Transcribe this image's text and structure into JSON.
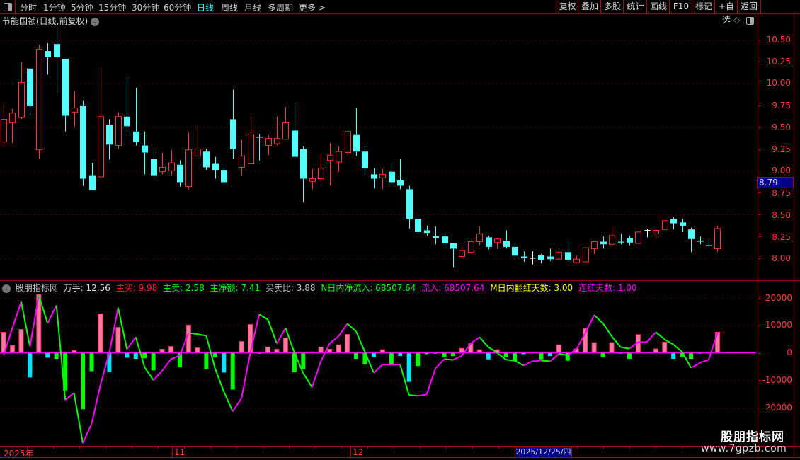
{
  "toolbar": {
    "periods": [
      "分时",
      "1分钟",
      "5分钟",
      "15分钟",
      "30分钟",
      "60分钟",
      "日线",
      "周线",
      "月线",
      "多周期",
      "更多 >"
    ],
    "active_period": "日线",
    "buttons": [
      "复权",
      "叠加",
      "多股",
      "统计",
      "画线",
      "F10",
      "标记",
      "+自选",
      "返回"
    ]
  },
  "price_chart": {
    "title": "节能国祯(日线,前复权)",
    "axis_labels": [
      "10.50",
      "10.25",
      "10.00",
      "9.75",
      "9.50",
      "9.25",
      "9.00",
      "8.75",
      "8.50",
      "8.25",
      "8.00"
    ],
    "axis_values": [
      10.5,
      10.25,
      10.0,
      9.75,
      9.5,
      9.25,
      9.0,
      8.75,
      8.5,
      8.25,
      8.0
    ],
    "current_price": "8.79",
    "colors": {
      "up": "#ff3232",
      "down": "#54ffff",
      "flat": "#ffffff",
      "grid": "#8b0000"
    }
  },
  "indicator": {
    "name": "股朋指标网",
    "fields": [
      {
        "text": "万手: 12.56",
        "color": "#e0e0e0"
      },
      {
        "text": "主买: 9.98",
        "color": "#ff2020"
      },
      {
        "text": "主卖: 2.58",
        "color": "#00ff00"
      },
      {
        "text": "主净额: 7.41",
        "color": "#00ff00"
      },
      {
        "text": "买卖比: 3.88",
        "color": "#c8c8c8"
      },
      {
        "text": "N日内净流入: 68507.64",
        "color": "#00ff00"
      },
      {
        "text": "流入: 68507.64",
        "color": "#ff00ff"
      },
      {
        "text": "M日内翻红天数: 3.00",
        "color": "#ffff00"
      },
      {
        "text": "连红天数: 1.00",
        "color": "#ff00ff"
      }
    ],
    "axis_labels": [
      "20000",
      "10000",
      "0",
      "-10000",
      "-20000"
    ],
    "axis_values": [
      20000,
      10000,
      0,
      -10000,
      -20000
    ]
  },
  "date_axis": {
    "labels": [
      "2025年",
      "11",
      "12"
    ],
    "cursor_date": "2025/12/25/四"
  },
  "watermark": {
    "name": "股朋指标网",
    "url": "www.7gpzb.com"
  },
  "chart_data": [
    {
      "type": "candlestick",
      "title": "节能国祯(日线,前复权)",
      "ylim": [
        7.8,
        10.7
      ],
      "fields": [
        "open",
        "high",
        "low",
        "close"
      ],
      "ohlc": [
        [
          9.33,
          9.77,
          9.28,
          9.59
        ],
        [
          9.55,
          9.71,
          9.32,
          9.66
        ],
        [
          9.61,
          10.24,
          9.59,
          10.01
        ],
        [
          10.17,
          10.17,
          9.63,
          9.74
        ],
        [
          9.24,
          10.44,
          9.14,
          10.39
        ],
        [
          10.37,
          10.46,
          10.1,
          10.3
        ],
        [
          10.45,
          10.63,
          9.89,
          10.3
        ],
        [
          10.28,
          10.28,
          9.45,
          9.63
        ],
        [
          9.67,
          9.91,
          9.5,
          9.72
        ],
        [
          9.74,
          9.8,
          8.83,
          8.91
        ],
        [
          8.95,
          9.09,
          8.78,
          8.78
        ],
        [
          8.93,
          10.18,
          8.93,
          9.62
        ],
        [
          9.53,
          9.59,
          9.13,
          9.3
        ],
        [
          9.29,
          9.67,
          9.25,
          9.62
        ],
        [
          9.62,
          10.07,
          9.45,
          9.51
        ],
        [
          9.45,
          9.95,
          9.29,
          9.33
        ],
        [
          9.29,
          9.45,
          8.96,
          9.21
        ],
        [
          9.14,
          9.24,
          8.91,
          8.95
        ],
        [
          8.99,
          9.21,
          8.96,
          9.04
        ],
        [
          9.0,
          9.24,
          8.95,
          9.09
        ],
        [
          9.07,
          9.12,
          8.82,
          8.87
        ],
        [
          8.82,
          9.44,
          8.79,
          9.24
        ],
        [
          9.17,
          9.53,
          9.17,
          9.25
        ],
        [
          9.22,
          9.25,
          9.01,
          9.04
        ],
        [
          9.08,
          9.16,
          8.91,
          9.01
        ],
        [
          9.01,
          9.03,
          8.86,
          8.87
        ],
        [
          9.59,
          9.93,
          9.14,
          9.25
        ],
        [
          9.04,
          9.35,
          8.95,
          9.17
        ],
        [
          9.08,
          9.62,
          9.08,
          9.42
        ],
        [
          9.39,
          9.42,
          9.12,
          9.38
        ],
        [
          9.29,
          9.41,
          9.18,
          9.37
        ],
        [
          9.31,
          9.62,
          9.29,
          9.37
        ],
        [
          9.36,
          9.73,
          9.36,
          9.55
        ],
        [
          9.46,
          9.78,
          9.16,
          9.16
        ],
        [
          9.25,
          9.28,
          8.64,
          8.91
        ],
        [
          8.88,
          9.02,
          8.79,
          8.91
        ],
        [
          8.91,
          9.2,
          8.87,
          9.03
        ],
        [
          9.12,
          9.32,
          8.83,
          9.18
        ],
        [
          9.1,
          9.28,
          8.99,
          9.22
        ],
        [
          9.21,
          9.45,
          9.17,
          9.45
        ],
        [
          9.41,
          9.72,
          9.17,
          9.22
        ],
        [
          9.22,
          9.28,
          8.95,
          9.03
        ],
        [
          8.96,
          9.03,
          8.8,
          8.91
        ],
        [
          8.92,
          9.02,
          8.79,
          8.96
        ],
        [
          8.99,
          9.08,
          8.84,
          8.87
        ],
        [
          8.89,
          9.14,
          8.79,
          8.83
        ],
        [
          8.79,
          8.83,
          8.34,
          8.45
        ],
        [
          8.45,
          8.45,
          8.28,
          8.3
        ],
        [
          8.32,
          8.37,
          8.26,
          8.29
        ],
        [
          8.25,
          8.36,
          8.16,
          8.23
        ],
        [
          8.25,
          8.3,
          8.11,
          8.17
        ],
        [
          8.17,
          8.17,
          7.9,
          8.11
        ],
        [
          8.02,
          8.15,
          8.02,
          8.09
        ],
        [
          8.07,
          8.2,
          8.07,
          8.19
        ],
        [
          8.19,
          8.36,
          8.15,
          8.28
        ],
        [
          8.24,
          8.26,
          8.1,
          8.13
        ],
        [
          8.18,
          8.23,
          8.11,
          8.22
        ],
        [
          8.2,
          8.32,
          8.11,
          8.13
        ],
        [
          8.13,
          8.17,
          8.01,
          8.03
        ],
        [
          8.02,
          8.08,
          7.96,
          8.0
        ],
        [
          8.0,
          8.08,
          7.93,
          8.0
        ],
        [
          8.04,
          8.05,
          7.94,
          7.98
        ],
        [
          8.02,
          8.11,
          7.97,
          7.99
        ],
        [
          7.99,
          8.11,
          7.99,
          8.07
        ],
        [
          8.07,
          8.2,
          7.96,
          7.98
        ],
        [
          7.95,
          8.03,
          7.94,
          7.99
        ],
        [
          7.96,
          8.12,
          7.96,
          8.12
        ],
        [
          8.11,
          8.19,
          8.05,
          8.19
        ],
        [
          8.19,
          8.25,
          8.11,
          8.16
        ],
        [
          8.16,
          8.35,
          8.14,
          8.26
        ],
        [
          8.19,
          8.28,
          8.16,
          8.18
        ],
        [
          8.23,
          8.26,
          8.15,
          8.18
        ],
        [
          8.17,
          8.31,
          8.17,
          8.3
        ],
        [
          8.32,
          8.34,
          8.24,
          8.32
        ],
        [
          8.28,
          8.32,
          8.23,
          8.32
        ],
        [
          8.33,
          8.43,
          8.32,
          8.43
        ],
        [
          8.45,
          8.47,
          8.33,
          8.4
        ],
        [
          8.41,
          8.45,
          8.3,
          8.37
        ],
        [
          8.33,
          8.35,
          8.07,
          8.22
        ],
        [
          8.2,
          8.25,
          8.16,
          8.19
        ],
        [
          8.15,
          8.22,
          8.11,
          8.14
        ],
        [
          8.11,
          8.37,
          8.07,
          8.34
        ]
      ]
    },
    {
      "type": "bar+line",
      "title": "股朋指标网",
      "ylim": [
        -25000,
        25000
      ],
      "bars": [
        7500,
        2600,
        8500,
        -9000,
        21200,
        -1800,
        -2200,
        -13700,
        800,
        -20600,
        -6700,
        14200,
        -7000,
        9300,
        -1800,
        -2200,
        -2000,
        -6400,
        1300,
        2300,
        -5200,
        10100,
        1800,
        -5900,
        -1500,
        -7200,
        -13400,
        4100,
        10300,
        -300,
        2100,
        1300,
        5400,
        -7100,
        -5900,
        300,
        2100,
        1300,
        2900,
        6700,
        -2200,
        -4300,
        -1400,
        1100,
        -4300,
        -1200,
        -10600,
        -4800,
        -500,
        -300,
        -1400,
        -1200,
        1600,
        3400,
        1100,
        -2400,
        1100,
        -1600,
        -3100,
        -500,
        0,
        -2400,
        -1200,
        2900,
        -2900,
        1400,
        8800,
        3700,
        -1400,
        3700,
        -300,
        -2200,
        6600,
        0,
        1400,
        3900,
        -2200,
        -1400,
        -2200,
        -300,
        -200,
        7500
      ],
      "cyan_bar_indices": [
        3,
        5,
        12,
        14,
        15,
        25,
        29,
        42,
        45,
        46,
        49,
        55,
        59,
        62,
        70,
        76,
        79,
        80
      ],
      "line": [
        -1000,
        9000,
        18600,
        2300,
        21000,
        10800,
        17300,
        -17200,
        -14700,
        -33000,
        -25800,
        -11600,
        0,
        16500,
        1300,
        5700,
        -5200,
        -10000,
        -6500,
        -2300,
        -900,
        7200,
        6800,
        6200,
        -5700,
        -14200,
        -21400,
        -16500,
        0,
        14000,
        12100,
        3400,
        9000,
        0,
        -7400,
        -12600,
        -3100,
        3400,
        6000,
        10600,
        7800,
        300,
        -7300,
        -4300,
        -4300,
        -4300,
        -15400,
        -15700,
        -15200,
        -5700,
        -2300,
        -2600,
        -1000,
        3400,
        5700,
        2100,
        0,
        -2500,
        -2900,
        -4600,
        -3100,
        -2800,
        -3100,
        -400,
        -900,
        1300,
        7200,
        13700,
        10800,
        6000,
        2100,
        1500,
        3900,
        3900,
        7500,
        4900,
        3000,
        300,
        -5500,
        -3700,
        -2500,
        7200
      ],
      "colors": {
        "pos_bar": "#ff3366",
        "neg_bar": "#00ff00",
        "neg_bar_alt": "#00e5ff",
        "line_up": "#ff00ff",
        "line_down": "#00ff00",
        "zero": "#ff00ff"
      }
    }
  ]
}
